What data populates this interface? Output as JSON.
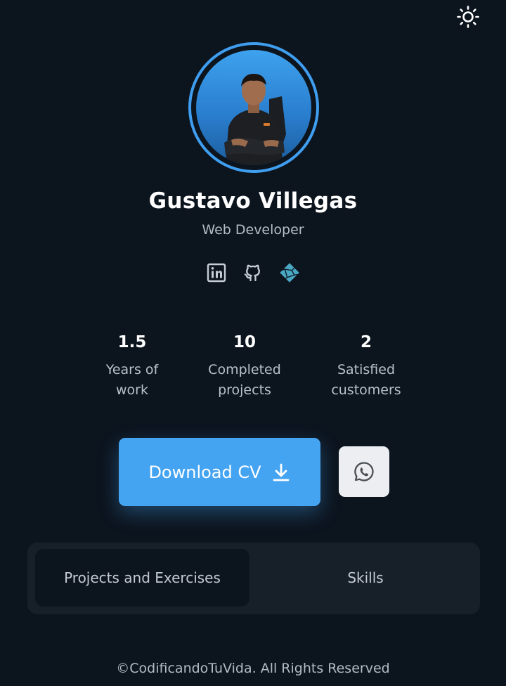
{
  "header": {
    "theme_icon": "sun-icon"
  },
  "profile": {
    "name": "Gustavo Villegas",
    "role": "Web Developer",
    "avatar": "profile-photo"
  },
  "socials": [
    {
      "icon": "linkedin-icon"
    },
    {
      "icon": "github-icon"
    },
    {
      "icon": "netlify-icon"
    }
  ],
  "stats": [
    {
      "value": "1.5",
      "label_line1": "Years of",
      "label_line2": "work"
    },
    {
      "value": "10",
      "label_line1": "Completed",
      "label_line2": "projects"
    },
    {
      "value": "2",
      "label_line1": "Satisfied",
      "label_line2": "customers"
    }
  ],
  "actions": {
    "download_label": "Download CV",
    "download_icon": "download-icon",
    "whatsapp_icon": "whatsapp-icon"
  },
  "tabs": [
    {
      "label": "Projects and Exercises",
      "active": true
    },
    {
      "label": "Skills",
      "active": false
    }
  ],
  "footer": {
    "text": "©CodificandoTuVida. All Rights Reserved"
  },
  "colors": {
    "background": "#0c141e",
    "accent": "#45a4f2",
    "panel": "#172029",
    "netlify": "#4aa7c3"
  }
}
